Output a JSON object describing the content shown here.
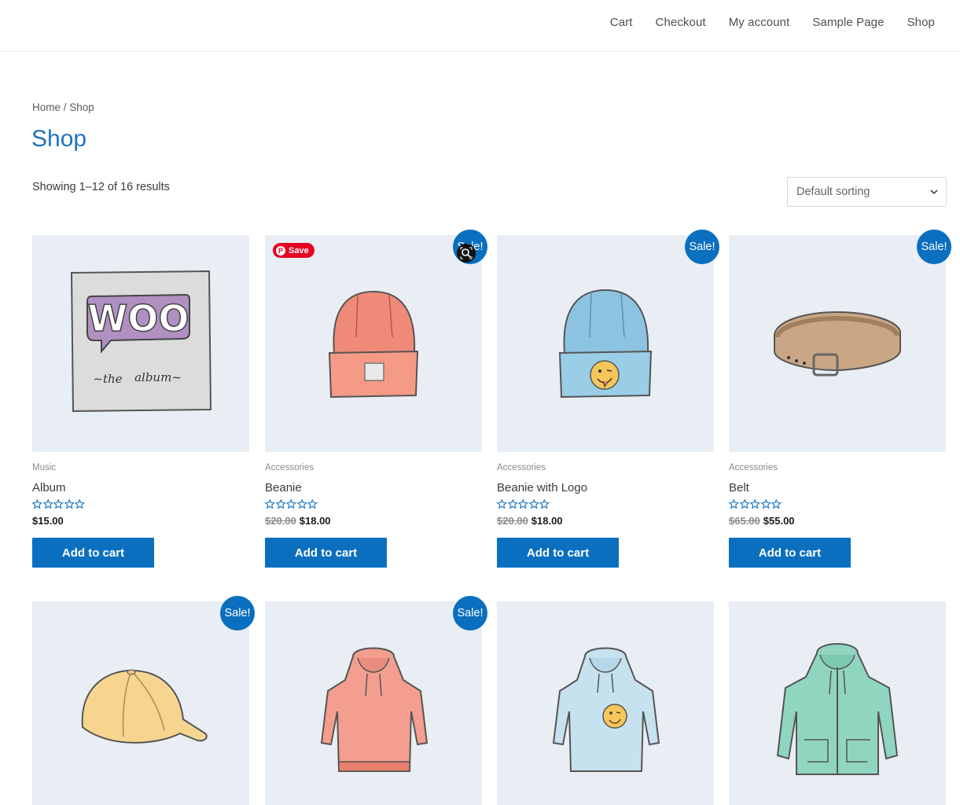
{
  "nav": {
    "items": [
      "Cart",
      "Checkout",
      "My account",
      "Sample Page",
      "Shop"
    ]
  },
  "breadcrumb": {
    "home": "Home",
    "separator": " / ",
    "current": "Shop"
  },
  "page": {
    "title": "Shop",
    "result_count": "Showing 1–12 of 16 results"
  },
  "ordering": {
    "selected": "Default sorting"
  },
  "pinterest": {
    "save_label": "Save"
  },
  "colors": {
    "accent": "#0a6fbf",
    "title_blue": "#1e73be",
    "image_bg": "#e9eef4",
    "pinterest": "#e60023"
  },
  "products": [
    {
      "category": "Music",
      "title": "Album",
      "regular_price": "",
      "price": "$15.00",
      "sale": "",
      "button": "Add to cart",
      "art": "album-art",
      "rating": 0
    },
    {
      "category": "Accessories",
      "title": "Beanie",
      "regular_price": "$20.00",
      "price": "$18.00",
      "sale": "Sale!",
      "button": "Add to cart",
      "art": "beanie-art",
      "rating": 0
    },
    {
      "category": "Accessories",
      "title": "Beanie with Logo",
      "regular_price": "$20.00",
      "price": "$18.00",
      "sale": "Sale!",
      "button": "Add to cart",
      "art": "beanie-logo-art",
      "rating": 0
    },
    {
      "category": "Accessories",
      "title": "Belt",
      "regular_price": "$65.00",
      "price": "$55.00",
      "sale": "Sale!",
      "button": "Add to cart",
      "art": "belt-art",
      "rating": 0
    },
    {
      "category": "",
      "title": "",
      "regular_price": "",
      "price": "",
      "sale": "Sale!",
      "button": "",
      "art": "cap-art"
    },
    {
      "category": "",
      "title": "",
      "regular_price": "",
      "price": "",
      "sale": "Sale!",
      "button": "",
      "art": "hoodie-art"
    },
    {
      "category": "",
      "title": "",
      "regular_price": "",
      "price": "",
      "sale": "",
      "button": "",
      "art": "hoodie-logo-art"
    },
    {
      "category": "",
      "title": "",
      "regular_price": "",
      "price": "",
      "sale": "",
      "button": "",
      "art": "zip-hoodie-art"
    }
  ]
}
